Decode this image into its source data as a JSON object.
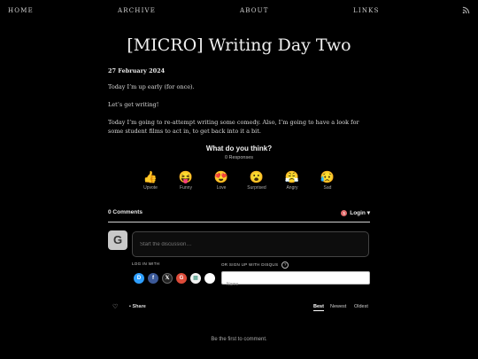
{
  "nav": {
    "home": "HOME",
    "archive": "ARCHIVE",
    "about": "ABOUT",
    "links": "LINKS",
    "rss_icon": "rss-icon"
  },
  "post": {
    "title": "[MICRO] Writing Day Two",
    "date": "27 February 2024",
    "paragraphs": [
      "Today I’m up early (for once).",
      "Let’s get writing!",
      "Today I’m going to re-attempt writing some comedy. Also, I’m going to have a look for some student films to act in, to get back into it a bit."
    ]
  },
  "reactions": {
    "heading": "What do you think?",
    "responses": "0 Responses",
    "items": [
      {
        "emoji": "👍",
        "label": "Upvote"
      },
      {
        "emoji": "😝",
        "label": "Funny"
      },
      {
        "emoji": "😍",
        "label": "Love"
      },
      {
        "emoji": "😮",
        "label": "Surprised"
      },
      {
        "emoji": "😤",
        "label": "Angry"
      },
      {
        "emoji": "😥",
        "label": "Sad"
      }
    ]
  },
  "comments": {
    "count": "0 Comments",
    "login": "Login",
    "login_badge": "1",
    "avatar_letter": "G",
    "placeholder": "Start the discussion…",
    "log_in_with": "LOG IN WITH",
    "sign_up": "OR SIGN UP WITH DISQUS",
    "help": "?",
    "name_placeholder": "Name",
    "social": [
      {
        "name": "disqus-icon",
        "glyph": "D",
        "color": "#2e9fff"
      },
      {
        "name": "facebook-icon",
        "glyph": "f",
        "color": "#3b5998"
      },
      {
        "name": "x-icon",
        "glyph": "𝕏",
        "color": "#222222"
      },
      {
        "name": "google-icon",
        "glyph": "G",
        "color": "#dd4b39"
      },
      {
        "name": "microsoft-icon",
        "glyph": "▦",
        "color": "#f2f2f2"
      },
      {
        "name": "apple-icon",
        "glyph": "",
        "color": "#ffffff"
      }
    ],
    "share": "Share",
    "sort": {
      "best": "Best",
      "newest": "Newest",
      "oldest": "Oldest"
    },
    "empty": "Be the first to comment."
  }
}
